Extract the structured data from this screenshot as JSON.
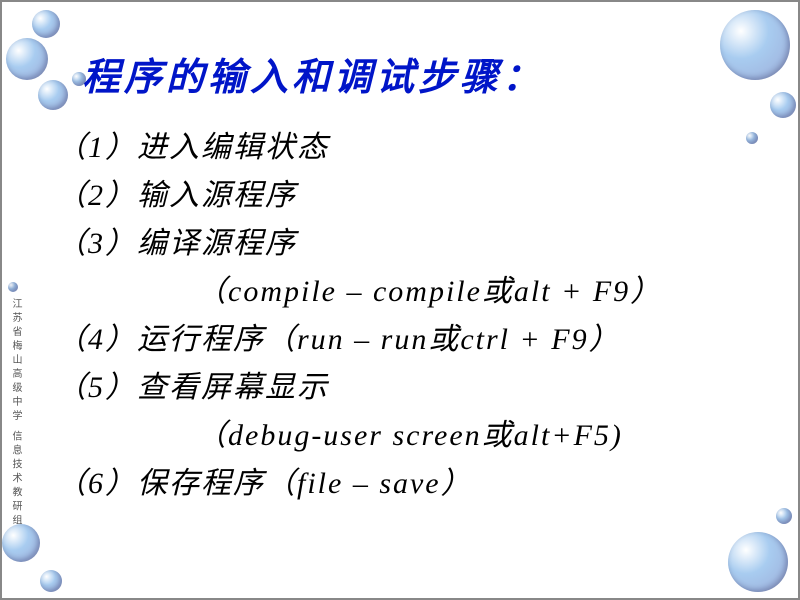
{
  "title": "程序的输入和调试步骤：",
  "steps": {
    "s1": "（1）进入编辑状态",
    "s2": "（2）输入源程序",
    "s3": "（3）编译源程序",
    "s3b": "（compile – compile或alt + F9）",
    "s4": "（4）运行程序（run – run或ctrl + F9）",
    "s5": "（5）查看屏幕显示",
    "s5b": "（debug-user screen或alt+F5)",
    "s6": "（6）保存程序（file – save）"
  },
  "footer": "江苏省梅山高级中学 信息技术教研组"
}
